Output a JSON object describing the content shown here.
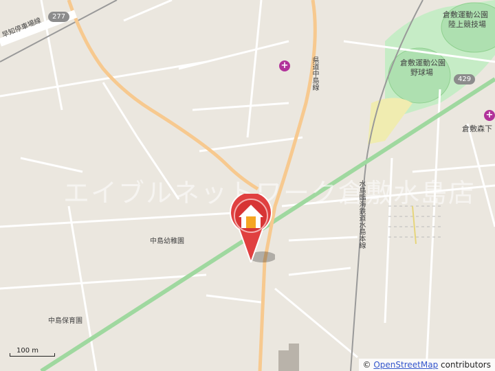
{
  "map": {
    "watermark": "エイブルネットワーク倉敷水島店",
    "labels": {
      "park1": "倉敷運動公園",
      "park1_sub": "陸上競技場",
      "park2": "倉敷運動公園",
      "park2_sub": "野球場",
      "nursery": "中島幼稚園",
      "daycare": "中島保育園",
      "kurashiki_mori": "倉敷森下",
      "rail_line": "水島臨海鉄道水島本線",
      "road_vertical": "県道中島線",
      "road_top_left": "早知停車場線"
    },
    "route_badges": [
      "277",
      "429"
    ],
    "scale_text": "100 m",
    "attribution": {
      "prefix": "© ",
      "link": "OpenStreetMap",
      "suffix": " contributors"
    },
    "colors": {
      "background": "#ebe7df",
      "park_green": "#b5e3b5",
      "major_road": "#f7c98f",
      "rail_green": "#9fd89f",
      "marker_red": "#e04040"
    }
  }
}
